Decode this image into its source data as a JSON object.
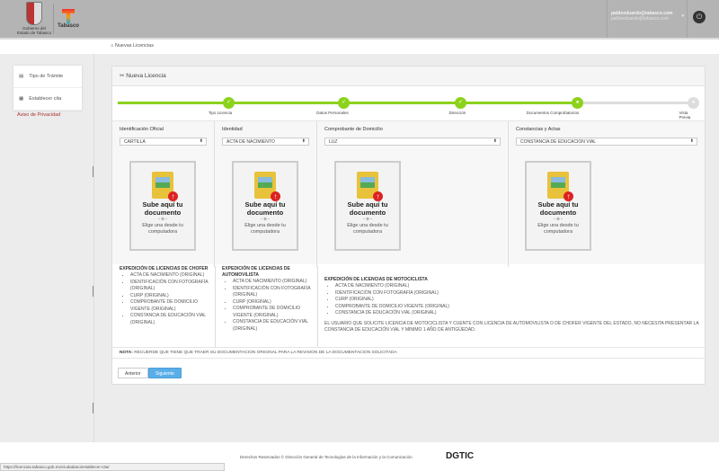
{
  "header": {
    "gov_logo_text": "Gobierno del Estado de Tabasco",
    "tabasco_logo_text": "Tabasco",
    "user_email": "pabloeduardo@tabasco.com",
    "user_email_secondary": "pabloeduardo@tabasco.com"
  },
  "breadcrumb": {
    "label": "Nuevas Licencias"
  },
  "sidebar": {
    "items": [
      {
        "label": "Tipo de Trámite"
      },
      {
        "label": "Establecer cita"
      }
    ],
    "privacy": "Aviso de Privacidad"
  },
  "panel": {
    "title": "Nueva Licencia",
    "steps": [
      {
        "label": "Tipo Licencia",
        "state": "done"
      },
      {
        "label": "Datos Personales",
        "state": "done"
      },
      {
        "label": "Dirección",
        "state": "done"
      },
      {
        "label": "Documentos Comprobatorios",
        "state": "current"
      },
      {
        "label": "Vista Previa",
        "state": "pending"
      }
    ],
    "columns": [
      {
        "title": "Identificación Oficial",
        "selected": "CARTILLA"
      },
      {
        "title": "Identidad",
        "selected": "ACTA DE NACIMIENTO"
      },
      {
        "title": "Comprobante de Domicilio",
        "selected": "LUZ"
      },
      {
        "title": "Constancias y Actas",
        "selected": "CONSTANCIA DE EDUCACION VIAL"
      }
    ],
    "upload": {
      "title": "Sube aquí tu documento",
      "or": "- o -",
      "sub": "Elige una desde tu computadora"
    },
    "requirements": [
      {
        "title": "EXPEDICIÓN DE LICENCIAS DE CHOFER",
        "items": [
          "ACTA DE NACIMIENTO (ORIGINAL)",
          "IDENTIFICACIÓN CON FOTOGRAFÍA (ORIGINAL)",
          "CURP (ORIGINAL)",
          "COMPROBANTE DE DOMICILIO VIGENTE (ORIGINAL)",
          "CONSTANCIA DE EDUCACIÓN VIAL (ORIGINAL)"
        ]
      },
      {
        "title": "EXPEDICIÓN DE LICENCIAS DE AUTOMOVILISTA",
        "items": [
          "ACTA DE NACIMIENTO (ORIGINAL)",
          "IDENTIFICACIÓN CON FOTOGRAFÍA (ORIGINAL)",
          "CURP (ORIGINAL)",
          "COMPROBANTE DE DOMICILIO VIGENTE (ORIGINAL)",
          "CONSTANCIA DE EDUCACIÓN VIAL (ORIGINAL)"
        ]
      },
      {
        "title": "EXPEDICIÓN DE LICENCIAS DE MOTOCICLISTA",
        "items": [
          "ACTA DE NACIMIENTO (ORIGINAL)",
          "IDENTIFICACIÓN CON FOTOGRAFÍA (ORIGINAL)",
          "CURP (ORIGINAL)",
          "COMPROBANTE DE DOMICILIO VIGENTE (ORIGINAL)",
          "CONSTANCIA DE EDUCACIÓN VIAL (ORIGINAL)"
        ],
        "note": "EL USUARIO QUE SOLICITE LICENCIA DE MOTOCICLISTA Y CUENTE CON LICENCIA DE AUTOMOVILISTA O DE CHOFER VIGENTE DEL ESTADO, NO NECESITA PRESENTAR LA CONSTANCIA DE EDUCACIÓN VIAL Y MÍNIMO 1 AÑO DE ANTIGÜEDAD."
      }
    ],
    "nota_label": "NOTA:",
    "nota_text": "RECUERDE QUE TIENE QUE TRAER SU DOCUMENTACION ORIGINAL PARA LA REVISION DE LA DOCUMENTACION SOLICITADA",
    "prev_label": "Anterior",
    "next_label": "Siguiente"
  },
  "footer": {
    "text": "Derechos Reservados © Dirección General de Tecnologías de la Información y la Comunicación",
    "logo": "DGTIC"
  },
  "status_url": "https://licencias.tabasco.gob.mx/ciudadano/establecer-cita/",
  "colors": {
    "accent": "#8cd21c",
    "primary_button": "#5aaee8",
    "header": "#b4b4b4"
  }
}
